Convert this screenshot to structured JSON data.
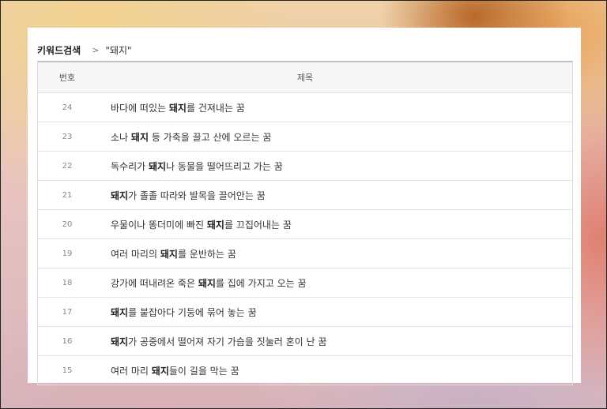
{
  "breadcrumb": {
    "root": "키워드검색",
    "separator": ">",
    "current": "\"돼지\""
  },
  "table": {
    "headers": {
      "number": "번호",
      "title": "제목"
    },
    "rows": [
      {
        "num": "24",
        "before": "바다에 떠있는 ",
        "keyword": "돼지",
        "after": "를 건져내는 꿈"
      },
      {
        "num": "23",
        "before": "소나 ",
        "keyword": "돼지",
        "after": " 등 가축을 끌고 산에 오르는 꿈"
      },
      {
        "num": "22",
        "before": "독수리가 ",
        "keyword": "돼지",
        "after": "나 동물을 떨어뜨리고 가는 꿈"
      },
      {
        "num": "21",
        "before": "",
        "keyword": "돼지",
        "after": "가 졸졸 따라와 발목을 끌어안는 꿈"
      },
      {
        "num": "20",
        "before": "우물이나 똥더미에 빠진 ",
        "keyword": "돼지",
        "after": "를 끄집어내는 꿈"
      },
      {
        "num": "19",
        "before": "여러 마리의 ",
        "keyword": "돼지",
        "after": "를 운반하는 꿈"
      },
      {
        "num": "18",
        "before": "강가에 떠내려온 죽은 ",
        "keyword": "돼지",
        "after": "를 집에 가지고 오는 꿈"
      },
      {
        "num": "17",
        "before": "",
        "keyword": "돼지",
        "after": "를 붙잡아다 기둥에 묶어 놓는 꿈"
      },
      {
        "num": "16",
        "before": "",
        "keyword": "돼지",
        "after": "가 공중에서 떨어져 자기 가슴을 짓눌러 혼이 난 꿈"
      },
      {
        "num": "15",
        "before": "여러 마리 ",
        "keyword": "돼지",
        "after": "들이 길을 막는 꿈"
      }
    ]
  }
}
